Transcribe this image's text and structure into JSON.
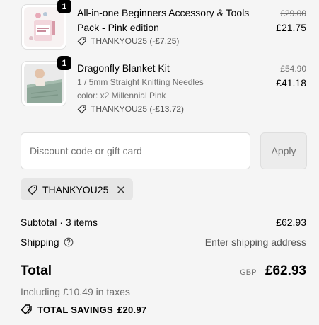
{
  "items": [
    {
      "quantity": "1",
      "title": "All-in-one Beginners Accessory & Tools Pack - Pink edition",
      "variant": "",
      "color": "",
      "discount": "THANKYOU25 (-£7.25)",
      "price_original": "£29.00",
      "price_final": "£21.75",
      "thumb_icon": "tools-pack-image"
    },
    {
      "quantity": "1",
      "title": "Dragonfly Blanket Kit",
      "variant": "1 / 5mm Straight Knitting Needles",
      "color": "color: x2 Millennial Pink",
      "discount": "THANKYOU25 (-£13.72)",
      "price_original": "£54.90",
      "price_final": "£41.18",
      "thumb_icon": "blanket-kit-image"
    }
  ],
  "discount_form": {
    "placeholder": "Discount code or gift card",
    "apply_label": "Apply"
  },
  "applied_code": {
    "label": "THANKYOU25",
    "remove_icon": "close-icon"
  },
  "summary": {
    "subtotal_label": "Subtotal · 3 items",
    "subtotal_value": "£62.93",
    "shipping_label": "Shipping",
    "shipping_value": "Enter shipping address",
    "total_label": "Total",
    "currency": "GBP",
    "total_value": "£62.93",
    "tax_line": "Including £10.49 in taxes",
    "savings_label": "TOTAL SAVINGS",
    "savings_value": "£20.97"
  },
  "colors": {
    "background": "#f5f5f5",
    "muted_text": "#707070",
    "border": "#dedede"
  }
}
